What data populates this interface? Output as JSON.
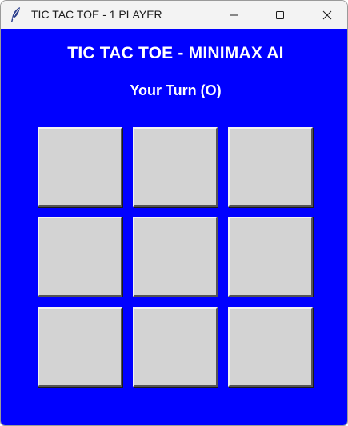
{
  "window": {
    "title": "TIC TAC TOE - 1 PLAYER",
    "icon": "feather-icon"
  },
  "colors": {
    "background": "#0000ff",
    "text": "#ffffff",
    "cell": "#d3d3d3"
  },
  "game": {
    "heading": "TIC TAC TOE - MINIMAX AI",
    "status": "Your Turn (O)",
    "board": [
      "",
      "",
      "",
      "",
      "",
      "",
      "",
      "",
      ""
    ]
  }
}
